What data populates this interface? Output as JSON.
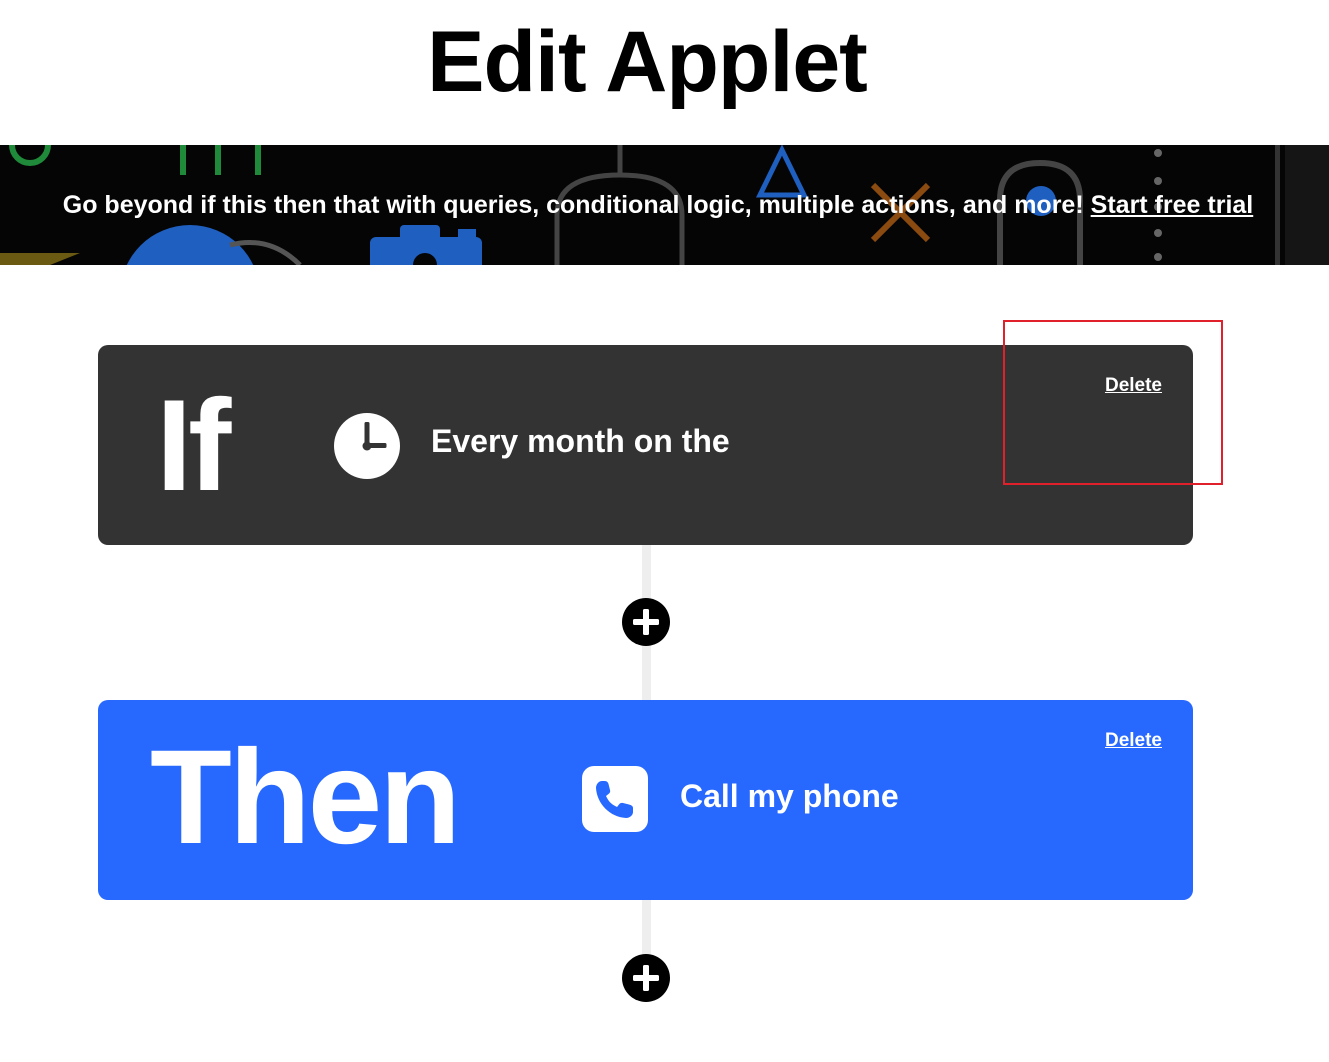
{
  "page": {
    "title": "Edit Applet"
  },
  "promo": {
    "text": "Go beyond if this then that with queries, conditional logic, multiple actions, and more!",
    "link_label": "Start free trial"
  },
  "trigger": {
    "keyword": "If",
    "label": "Every month on the",
    "icon": "clock-icon",
    "delete_label": "Delete",
    "color": "#333333"
  },
  "action": {
    "keyword": "Then",
    "label": "Call my phone",
    "icon": "phone-icon",
    "delete_label": "Delete",
    "color": "#2768ff"
  },
  "colors": {
    "highlight": "#e0202a",
    "connector": "#eeeeee"
  }
}
